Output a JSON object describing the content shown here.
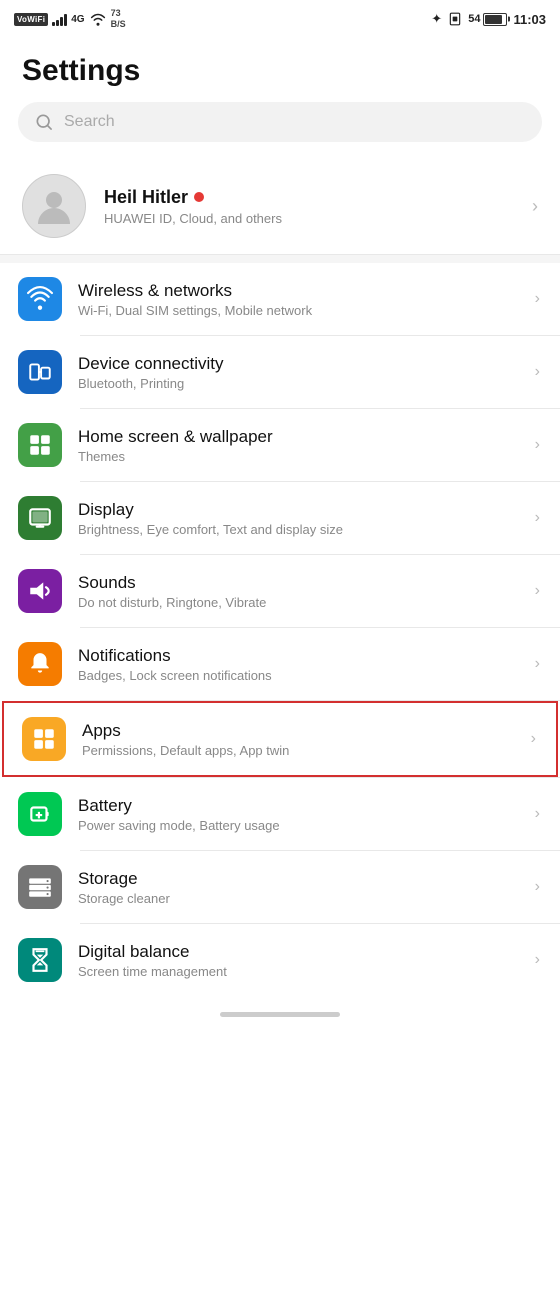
{
  "statusBar": {
    "leftItems": {
      "vowifi": "VoWiFi",
      "signal": "4G",
      "speed": "73\nB/S"
    },
    "rightItems": {
      "battery": "54",
      "time": "11:03"
    }
  },
  "page": {
    "title": "Settings"
  },
  "search": {
    "placeholder": "Search"
  },
  "profile": {
    "name": "Heil Hitler",
    "subtitle": "HUAWEI ID, Cloud, and others"
  },
  "settingsItems": [
    {
      "id": "wireless",
      "title": "Wireless & networks",
      "subtitle": "Wi-Fi, Dual SIM settings, Mobile network",
      "iconColor": "blue",
      "icon": "wifi"
    },
    {
      "id": "device",
      "title": "Device connectivity",
      "subtitle": "Bluetooth, Printing",
      "iconColor": "blue2",
      "icon": "device"
    },
    {
      "id": "homescreen",
      "title": "Home screen & wallpaper",
      "subtitle": "Themes",
      "iconColor": "green",
      "icon": "home"
    },
    {
      "id": "display",
      "title": "Display",
      "subtitle": "Brightness, Eye comfort, Text and display size",
      "iconColor": "green2",
      "icon": "display"
    },
    {
      "id": "sounds",
      "title": "Sounds",
      "subtitle": "Do not disturb, Ringtone, Vibrate",
      "iconColor": "purple",
      "icon": "sound"
    },
    {
      "id": "notifications",
      "title": "Notifications",
      "subtitle": "Badges, Lock screen notifications",
      "iconColor": "yellow",
      "icon": "bell"
    },
    {
      "id": "apps",
      "title": "Apps",
      "subtitle": "Permissions, Default apps, App twin",
      "iconColor": "orange",
      "icon": "apps",
      "highlighted": true
    },
    {
      "id": "battery",
      "title": "Battery",
      "subtitle": "Power saving mode, Battery usage",
      "iconColor": "green3",
      "icon": "battery"
    },
    {
      "id": "storage",
      "title": "Storage",
      "subtitle": "Storage cleaner",
      "iconColor": "gray",
      "icon": "storage"
    },
    {
      "id": "digitalbalance",
      "title": "Digital balance",
      "subtitle": "Screen time management",
      "iconColor": "teal",
      "icon": "hourglass"
    }
  ]
}
